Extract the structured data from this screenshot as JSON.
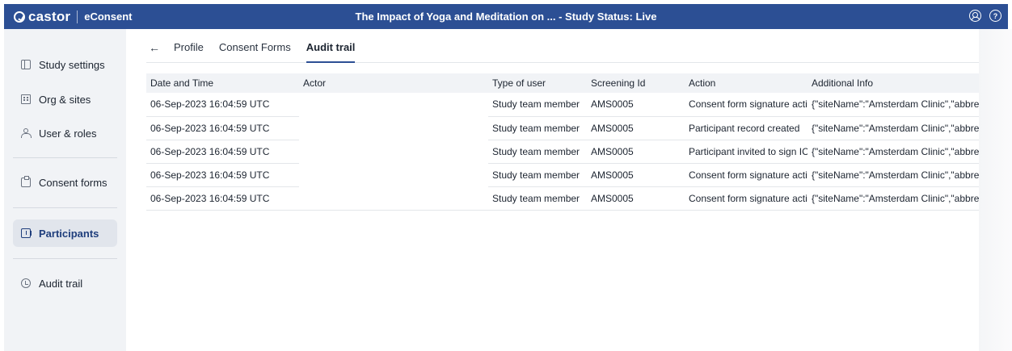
{
  "app": {
    "logo_text": "castor",
    "product": "eConsent",
    "title": "The Impact of Yoga and Meditation on ...  - Study Status: Live"
  },
  "top_icons": [
    "user-icon",
    "help-icon"
  ],
  "sidebar": {
    "items": [
      {
        "label": "Study settings",
        "icon": "settings-panel-icon"
      },
      {
        "label": "Org & sites",
        "icon": "building-icon"
      },
      {
        "label": "User & roles",
        "icon": "users-icon"
      },
      {
        "label": "Consent forms",
        "icon": "clipboard-icon"
      },
      {
        "label": "Participants",
        "icon": "participants-icon",
        "active": true
      },
      {
        "label": "Audit trail",
        "icon": "history-icon"
      }
    ]
  },
  "tabs": {
    "back_label": "←",
    "items": [
      {
        "label": "Profile"
      },
      {
        "label": "Consent Forms"
      },
      {
        "label": "Audit trail",
        "active": true
      }
    ]
  },
  "table": {
    "headers": [
      "Date and Time",
      "Actor",
      "Type of user",
      "Screening Id",
      "Action",
      "Additional Info"
    ],
    "rows": [
      [
        "06-Sep-2023 16:04:59 UTC",
        "",
        "Study team member",
        "AMS0005",
        "Consent form signature activate",
        "{\"siteName\":\"Amsterdam Clinic\",\"abbreviation\":\"/"
      ],
      [
        "06-Sep-2023 16:04:59 UTC",
        "",
        "Study team member",
        "AMS0005",
        "Participant record created",
        "{\"siteName\":\"Amsterdam Clinic\",\"abbreviation\":\"/"
      ],
      [
        "06-Sep-2023 16:04:59 UTC",
        "",
        "Study team member",
        "AMS0005",
        "Participant invited to sign ICF",
        "{\"siteName\":\"Amsterdam Clinic\",\"abbreviation\":\"/"
      ],
      [
        "06-Sep-2023 16:04:59 UTC",
        "",
        "Study team member",
        "AMS0005",
        "Consent form signature activate",
        "{\"siteName\":\"Amsterdam Clinic\",\"abbreviation\":\"/"
      ],
      [
        "06-Sep-2023 16:04:59 UTC",
        "",
        "Study team member",
        "AMS0005",
        "Consent form signature activate",
        "{\"siteName\":\"Amsterdam Clinic\",\"abbreviation\":\"/"
      ]
    ]
  },
  "colors": {
    "topbar": "#2c4f94",
    "sidebar_bg": "#f1f3f6",
    "active_tab_underline": "#2c4f94",
    "active_nav_text": "#1f3e7c"
  }
}
